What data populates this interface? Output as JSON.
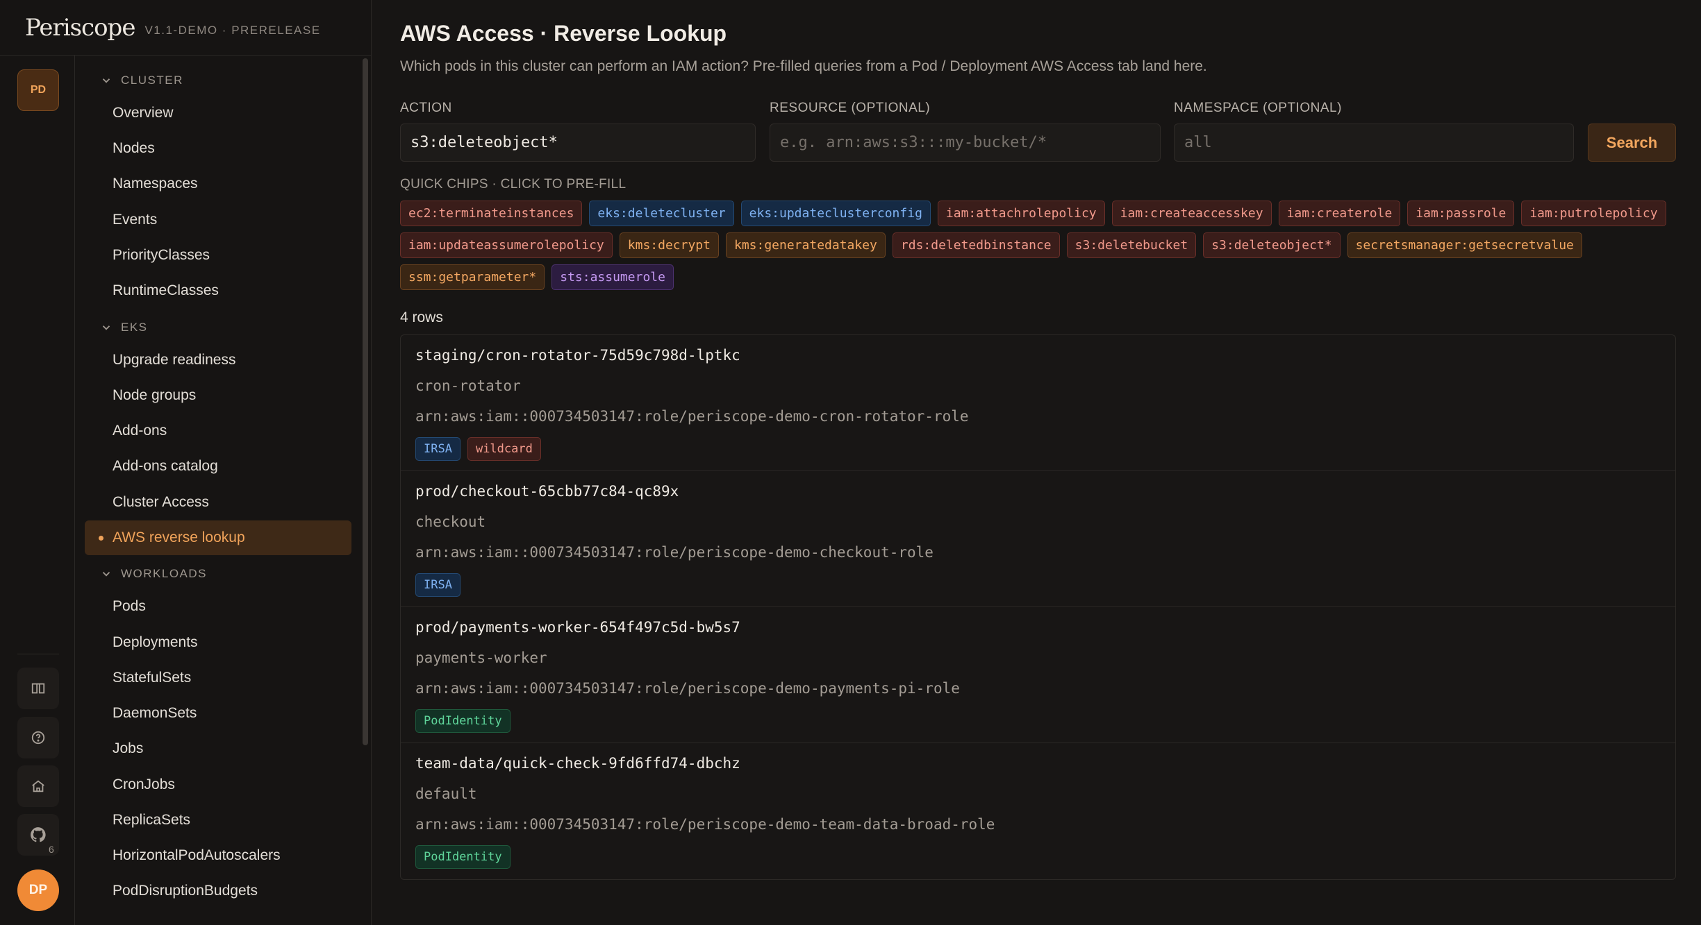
{
  "brand": {
    "logo": "Periscope",
    "version": "V1.1-DEMO · PRERELEASE"
  },
  "rail": {
    "project_badge": "PD",
    "github_count": "6",
    "user_initials": "DP"
  },
  "nav": {
    "sections": [
      {
        "label": "CLUSTER",
        "items": [
          "Overview",
          "Nodes",
          "Namespaces",
          "Events",
          "PriorityClasses",
          "RuntimeClasses"
        ]
      },
      {
        "label": "EKS",
        "items": [
          "Upgrade readiness",
          "Node groups",
          "Add-ons",
          "Add-ons catalog",
          "Cluster Access",
          "AWS reverse lookup"
        ]
      },
      {
        "label": "WORKLOADS",
        "items": [
          "Pods",
          "Deployments",
          "StatefulSets",
          "DaemonSets",
          "Jobs",
          "CronJobs",
          "ReplicaSets",
          "HorizontalPodAutoscalers",
          "PodDisruptionBudgets"
        ]
      }
    ],
    "active_item": "AWS reverse lookup"
  },
  "page": {
    "title": "AWS Access · Reverse Lookup",
    "subtitle": "Which pods in this cluster can perform an IAM action? Pre-filled queries from a Pod / Deployment AWS Access tab land here."
  },
  "form": {
    "action_label": "ACTION",
    "action_value": "s3:deleteobject*",
    "resource_label": "RESOURCE (OPTIONAL)",
    "resource_placeholder": "e.g. arn:aws:s3:::my-bucket/*",
    "namespace_label": "NAMESPACE (OPTIONAL)",
    "namespace_placeholder": "all",
    "search_label": "Search"
  },
  "chips_label": "QUICK CHIPS · CLICK TO PRE-FILL",
  "chips": [
    {
      "text": "ec2:terminateinstances",
      "color": "red"
    },
    {
      "text": "eks:deletecluster",
      "color": "blue"
    },
    {
      "text": "eks:updateclusterconfig",
      "color": "blue"
    },
    {
      "text": "iam:attachrolepolicy",
      "color": "red"
    },
    {
      "text": "iam:createaccesskey",
      "color": "red"
    },
    {
      "text": "iam:createrole",
      "color": "red"
    },
    {
      "text": "iam:passrole",
      "color": "red"
    },
    {
      "text": "iam:putrolepolicy",
      "color": "red"
    },
    {
      "text": "iam:updateassumerolepolicy",
      "color": "red"
    },
    {
      "text": "kms:decrypt",
      "color": "orange"
    },
    {
      "text": "kms:generatedatakey",
      "color": "orange"
    },
    {
      "text": "rds:deletedbinstance",
      "color": "red"
    },
    {
      "text": "s3:deletebucket",
      "color": "red"
    },
    {
      "text": "s3:deleteobject*",
      "color": "red"
    },
    {
      "text": "secretsmanager:getsecretvalue",
      "color": "orange"
    },
    {
      "text": "ssm:getparameter*",
      "color": "orange"
    },
    {
      "text": "sts:assumerole",
      "color": "purple"
    }
  ],
  "rows_count": "4 rows",
  "results": [
    {
      "pod": "staging/cron-rotator-75d59c798d-lptkc",
      "service_account": "cron-rotator",
      "role_arn": "arn:aws:iam::000734503147:role/periscope-demo-cron-rotator-role",
      "tags": [
        {
          "text": "IRSA",
          "kind": "irsa"
        },
        {
          "text": "wildcard",
          "kind": "wild"
        }
      ]
    },
    {
      "pod": "prod/checkout-65cbb77c84-qc89x",
      "service_account": "checkout",
      "role_arn": "arn:aws:iam::000734503147:role/periscope-demo-checkout-role",
      "tags": [
        {
          "text": "IRSA",
          "kind": "irsa"
        }
      ]
    },
    {
      "pod": "prod/payments-worker-654f497c5d-bw5s7",
      "service_account": "payments-worker",
      "role_arn": "arn:aws:iam::000734503147:role/periscope-demo-payments-pi-role",
      "tags": [
        {
          "text": "PodIdentity",
          "kind": "podid"
        }
      ]
    },
    {
      "pod": "team-data/quick-check-9fd6ffd74-dbchz",
      "service_account": "default",
      "role_arn": "arn:aws:iam::000734503147:role/periscope-demo-team-data-broad-role",
      "tags": [
        {
          "text": "PodIdentity",
          "kind": "podid"
        }
      ]
    }
  ]
}
